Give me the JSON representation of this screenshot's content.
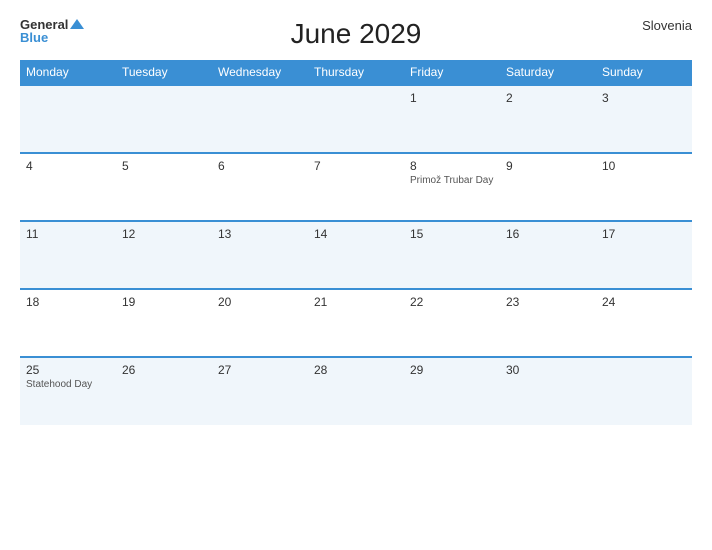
{
  "header": {
    "title": "June 2029",
    "country": "Slovenia",
    "logo_general": "General",
    "logo_blue": "Blue"
  },
  "weekdays": [
    "Monday",
    "Tuesday",
    "Wednesday",
    "Thursday",
    "Friday",
    "Saturday",
    "Sunday"
  ],
  "weeks": [
    [
      {
        "day": "",
        "holiday": ""
      },
      {
        "day": "",
        "holiday": ""
      },
      {
        "day": "",
        "holiday": ""
      },
      {
        "day": "",
        "holiday": ""
      },
      {
        "day": "1",
        "holiday": ""
      },
      {
        "day": "2",
        "holiday": ""
      },
      {
        "day": "3",
        "holiday": ""
      }
    ],
    [
      {
        "day": "4",
        "holiday": ""
      },
      {
        "day": "5",
        "holiday": ""
      },
      {
        "day": "6",
        "holiday": ""
      },
      {
        "day": "7",
        "holiday": ""
      },
      {
        "day": "8",
        "holiday": "Primož Trubar Day"
      },
      {
        "day": "9",
        "holiday": ""
      },
      {
        "day": "10",
        "holiday": ""
      }
    ],
    [
      {
        "day": "11",
        "holiday": ""
      },
      {
        "day": "12",
        "holiday": ""
      },
      {
        "day": "13",
        "holiday": ""
      },
      {
        "day": "14",
        "holiday": ""
      },
      {
        "day": "15",
        "holiday": ""
      },
      {
        "day": "16",
        "holiday": ""
      },
      {
        "day": "17",
        "holiday": ""
      }
    ],
    [
      {
        "day": "18",
        "holiday": ""
      },
      {
        "day": "19",
        "holiday": ""
      },
      {
        "day": "20",
        "holiday": ""
      },
      {
        "day": "21",
        "holiday": ""
      },
      {
        "day": "22",
        "holiday": ""
      },
      {
        "day": "23",
        "holiday": ""
      },
      {
        "day": "24",
        "holiday": ""
      }
    ],
    [
      {
        "day": "25",
        "holiday": "Statehood Day"
      },
      {
        "day": "26",
        "holiday": ""
      },
      {
        "day": "27",
        "holiday": ""
      },
      {
        "day": "28",
        "holiday": ""
      },
      {
        "day": "29",
        "holiday": ""
      },
      {
        "day": "30",
        "holiday": ""
      },
      {
        "day": "",
        "holiday": ""
      }
    ]
  ]
}
